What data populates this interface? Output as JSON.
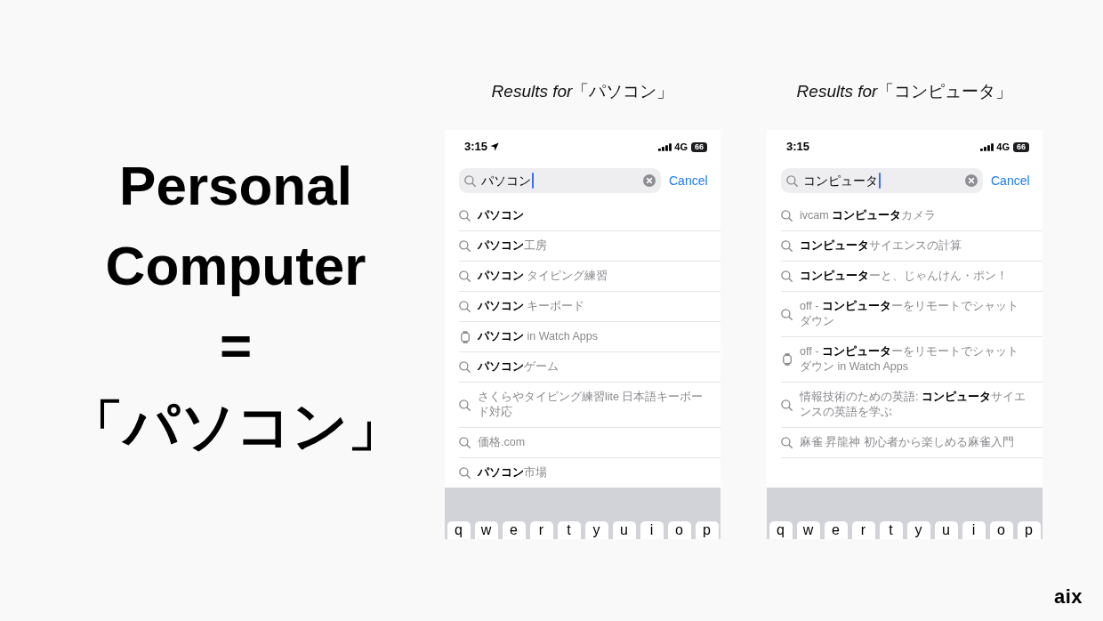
{
  "title_lines": [
    "Personal",
    "Computer",
    "=",
    "「パソコン」"
  ],
  "panels": [
    {
      "heading": "*Results for*「パソコン」",
      "status_bar": {
        "time": "3:15",
        "location": true,
        "network": "4G",
        "battery": "66"
      },
      "search": {
        "value": "パソコン",
        "focused": true,
        "cancel": "Cancel"
      },
      "suggestions": [
        {
          "kind": "search",
          "full_match": true,
          "text": "パソコン"
        },
        {
          "kind": "search",
          "full_match": false,
          "text": "**パソコン**工房"
        },
        {
          "kind": "search",
          "full_match": false,
          "text": "**パソコン** タイピング練習"
        },
        {
          "kind": "search",
          "full_match": false,
          "text": "**パソコン** キーボード"
        },
        {
          "kind": "watch_app",
          "full_match": false,
          "text": "**パソコン** in Watch Apps"
        },
        {
          "kind": "search",
          "full_match": false,
          "text": "**パソコン**ゲーム"
        },
        {
          "kind": "search",
          "full_match": false,
          "text": "さくらやタイピング練習lite 日本語キーボード対応"
        },
        {
          "kind": "search",
          "full_match": false,
          "text": "価格.com"
        },
        {
          "kind": "search",
          "full_match": false,
          "text": "**パソコン**市場"
        }
      ],
      "keyboard_keys": [
        "q",
        "w",
        "e",
        "r",
        "t",
        "y",
        "u",
        "i",
        "o",
        "p"
      ]
    },
    {
      "heading": "*Results for*「コンピュータ」",
      "status_bar": {
        "time": "3:15",
        "location": false,
        "network": "4G",
        "battery": "66"
      },
      "search": {
        "value": "コンピュータ",
        "focused": true,
        "cancel": "Cancel"
      },
      "suggestions": [
        {
          "kind": "search",
          "full_match": false,
          "text": "ivcam **コンピュータ**カメラ"
        },
        {
          "kind": "search",
          "full_match": false,
          "text": "**コンピュータ**サイエンスの計算"
        },
        {
          "kind": "search",
          "full_match": false,
          "text": "**コンピュータ**ーと、じゃんけん・ポン！"
        },
        {
          "kind": "search",
          "full_match": false,
          "text": "off - **コンピュータ**ーをリモートでシャットダウン"
        },
        {
          "kind": "watch_app",
          "full_match": false,
          "text": "off - **コンピュータ**ーをリモートでシャットダウン in Watch Apps"
        },
        {
          "kind": "search",
          "full_match": false,
          "text": "情報技術のための英語: **コンピュータ**サイエンスの英語を学ぶ"
        },
        {
          "kind": "search",
          "full_match": false,
          "text": "麻雀 昇龍神 初心者から楽しめる麻雀入門"
        }
      ],
      "keyboard_keys": [
        "q",
        "w",
        "e",
        "r",
        "t",
        "y",
        "u",
        "i",
        "o",
        "p"
      ]
    }
  ],
  "logo": "aix"
}
